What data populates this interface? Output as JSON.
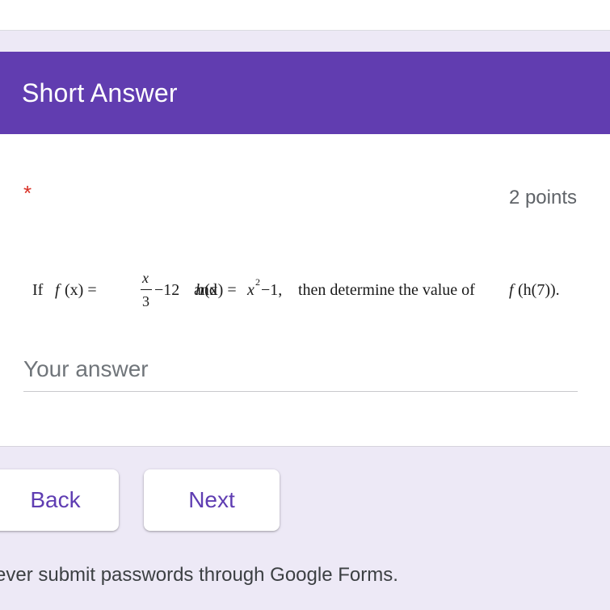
{
  "section": {
    "title": "Short Answer"
  },
  "question": {
    "required_marker": "*",
    "points": "2 points",
    "equation": {
      "if": "If",
      "f_lhs": "f",
      "f_paren": "(x) =",
      "frac_num": "x",
      "frac_den": "3",
      "after_frac": "−12",
      "and": "and",
      "h_lhs": "h",
      "h_paren": "(x) =",
      "x_var": "x",
      "exp": "2",
      "minus_one": "−1,",
      "then_text": "then determine the value of",
      "target_f": "f",
      "target_rest": "(h(7))."
    },
    "answer_placeholder": "Your answer",
    "answer_value": ""
  },
  "navigation": {
    "back_label": "Back",
    "next_label": "Next"
  },
  "footer": {
    "note": "ever submit passwords through Google Forms."
  },
  "colors": {
    "header_bg": "#613db0",
    "page_bg": "#ede9f6",
    "button_text": "#5f3db2",
    "required": "#d93025"
  }
}
